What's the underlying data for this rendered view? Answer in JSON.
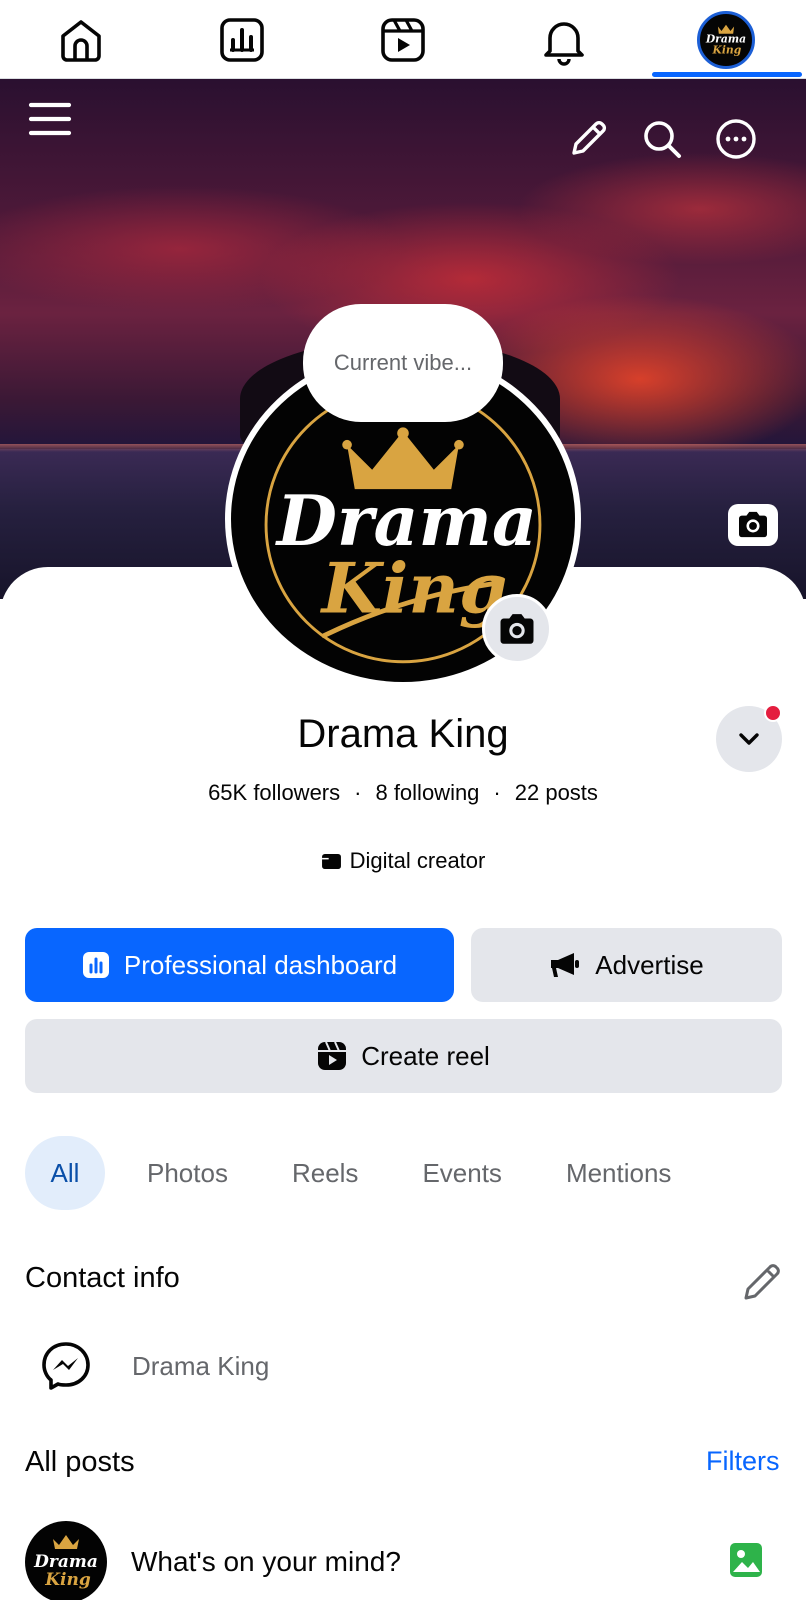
{
  "nav": {
    "items": [
      {
        "name": "home",
        "icon": "home-icon"
      },
      {
        "name": "dashboard",
        "icon": "dashboard-icon"
      },
      {
        "name": "reels",
        "icon": "reels-icon"
      },
      {
        "name": "notifications",
        "icon": "bell-icon"
      },
      {
        "name": "profile",
        "icon": "profile-avatar",
        "active": true
      }
    ],
    "accent": "#0866ff"
  },
  "cover": {
    "icons": [
      "menu-icon",
      "pencil-icon",
      "search-icon",
      "more-icon",
      "camera-icon"
    ]
  },
  "profile": {
    "vibe_placeholder": "Current vibe...",
    "logo_text_line1": "Drama",
    "logo_text_line2": "King",
    "name": "Drama King",
    "followers": "65K followers",
    "following": "8 following",
    "posts": "22 posts",
    "dot": "·",
    "category": "Digital creator"
  },
  "buttons": {
    "dashboard": "Professional dashboard",
    "advertise": "Advertise",
    "create_reel": "Create reel"
  },
  "tabs": [
    "All",
    "Photos",
    "Reels",
    "Events",
    "Mentions"
  ],
  "contact": {
    "title": "Contact info",
    "messenger_value": "Drama King"
  },
  "posts_section": {
    "title": "All posts",
    "filters": "Filters",
    "composer_prompt": "What's on your mind?"
  },
  "colors": {
    "primary": "#0866ff",
    "secondary_bg": "#e4e6eb",
    "tab_active_bg": "#e2edfb",
    "gold": "#d9a441",
    "notification": "#e41e3f",
    "photo_green": "#2eb34a"
  }
}
